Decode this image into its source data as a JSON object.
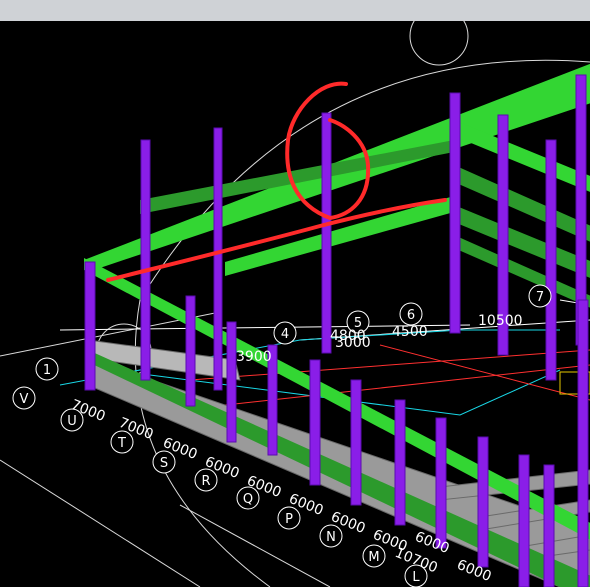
{
  "window": {
    "title": ""
  },
  "colors": {
    "background": "#000000",
    "column": "#8a1ee8",
    "beam_top": "#33d633",
    "beam_low": "#2c9a2c",
    "wall": "#9a9a9a",
    "redline": "#ff2a2a",
    "dim_text": "#ffffff",
    "cyan": "#19d7e6"
  },
  "grid_labels_left": [
    "1",
    "V",
    "U",
    "T",
    "S",
    "R",
    "Q",
    "P",
    "N",
    "M",
    "L"
  ],
  "grid_labels_top": [
    "4",
    "5",
    "6",
    "7"
  ],
  "dimensions_left": [
    "7000",
    "7000",
    "6000",
    "6000",
    "6000",
    "6000",
    "6000",
    "6000",
    "10700",
    "6000",
    "6000"
  ],
  "dimensions_top": [
    "3900",
    "4800",
    "3000",
    "4500",
    "10500"
  ],
  "annotations": {
    "red_sketch": "6"
  }
}
